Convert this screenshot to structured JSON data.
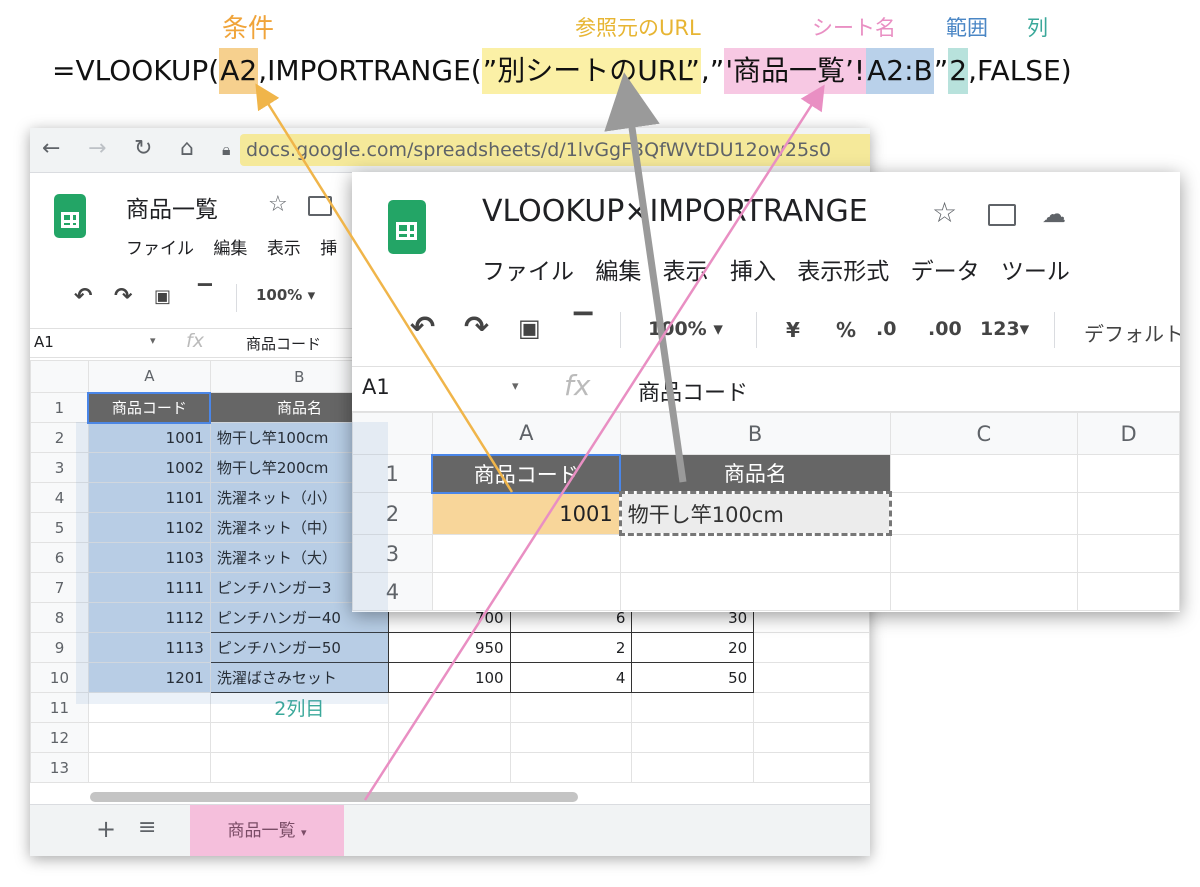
{
  "annotation": {
    "labels": {
      "condition": "条件",
      "source_url": "参照元のURL",
      "sheet_name": "シート名",
      "range": "範囲",
      "column": "列"
    },
    "formula": {
      "p1": "=VLOOKUP(",
      "p2": "A2",
      "p3": ",IMPORTRANGE(",
      "p4": "”別シートのURL”",
      "p5": ",”",
      "p6": "'商品一覧’!",
      "p7": "A2:B",
      "p8": "”",
      "p9": "2",
      "p10": ",FALSE)"
    },
    "column_note": "2列目",
    "colors": {
      "condition": "#f0a43a",
      "url": "#f0c040",
      "sheet": "#e98fc3",
      "range": "#4a86c5",
      "column": "#3aa89a"
    }
  },
  "back_window": {
    "address": "docs.google.com/spreadsheets/d/1lvGgF3QfWVtDU12ow25s0",
    "doc_title": "商品一覧",
    "menu": [
      "ファイル",
      "編集",
      "表示",
      "挿"
    ],
    "zoom": "100%",
    "cell_ref": "A1",
    "formula_content": "商品コード",
    "columns": [
      "A",
      "B"
    ],
    "rows": [
      {
        "n": "1",
        "a": "商品コード",
        "b": "商品名",
        "c": "",
        "d": "",
        "e": ""
      },
      {
        "n": "2",
        "a": "1001",
        "b": "物干し竿100cm",
        "c": "",
        "d": "",
        "e": ""
      },
      {
        "n": "3",
        "a": "1002",
        "b": "物干し竿200cm",
        "c": "",
        "d": "",
        "e": ""
      },
      {
        "n": "4",
        "a": "1101",
        "b": "洗濯ネット（小）",
        "c": "",
        "d": "",
        "e": ""
      },
      {
        "n": "5",
        "a": "1102",
        "b": "洗濯ネット（中）",
        "c": "",
        "d": "",
        "e": ""
      },
      {
        "n": "6",
        "a": "1103",
        "b": "洗濯ネット（大）",
        "c": "",
        "d": "",
        "e": ""
      },
      {
        "n": "7",
        "a": "1111",
        "b": "ピンチハンガー3",
        "c": "",
        "d": "",
        "e": ""
      },
      {
        "n": "8",
        "a": "1112",
        "b": "ピンチハンガー40",
        "c": "700",
        "d": "6",
        "e": "30"
      },
      {
        "n": "9",
        "a": "1113",
        "b": "ピンチハンガー50",
        "c": "950",
        "d": "2",
        "e": "20"
      },
      {
        "n": "10",
        "a": "1201",
        "b": "洗濯ばさみセット",
        "c": "100",
        "d": "4",
        "e": "50"
      },
      {
        "n": "11",
        "a": "",
        "b": "",
        "c": "",
        "d": "",
        "e": ""
      },
      {
        "n": "12",
        "a": "",
        "b": "",
        "c": "",
        "d": "",
        "e": ""
      },
      {
        "n": "13",
        "a": "",
        "b": "",
        "c": "",
        "d": "",
        "e": ""
      }
    ],
    "sheet_tab": "商品一覧",
    "add_sheet": "+",
    "all_sheets": "≡"
  },
  "front_window": {
    "doc_title": "VLOOKUP×IMPORTRANGE",
    "menu": [
      "ファイル",
      "編集",
      "表示",
      "挿入",
      "表示形式",
      "データ",
      "ツール"
    ],
    "zoom": "100%",
    "currency": "¥",
    "percent": "%",
    "dec_less": ".0",
    "dec_more": ".00",
    "more_formats": "123",
    "font": "デフォルト",
    "cell_ref": "A1",
    "formula_content": "商品コード",
    "columns": [
      "A",
      "B",
      "C",
      "D"
    ],
    "rows": [
      {
        "n": "1",
        "a": "商品コード",
        "b": "商品名"
      },
      {
        "n": "2",
        "a": "1001",
        "b": "物干し竿100cm"
      },
      {
        "n": "3",
        "a": "",
        "b": ""
      },
      {
        "n": "4",
        "a": "",
        "b": ""
      }
    ]
  }
}
